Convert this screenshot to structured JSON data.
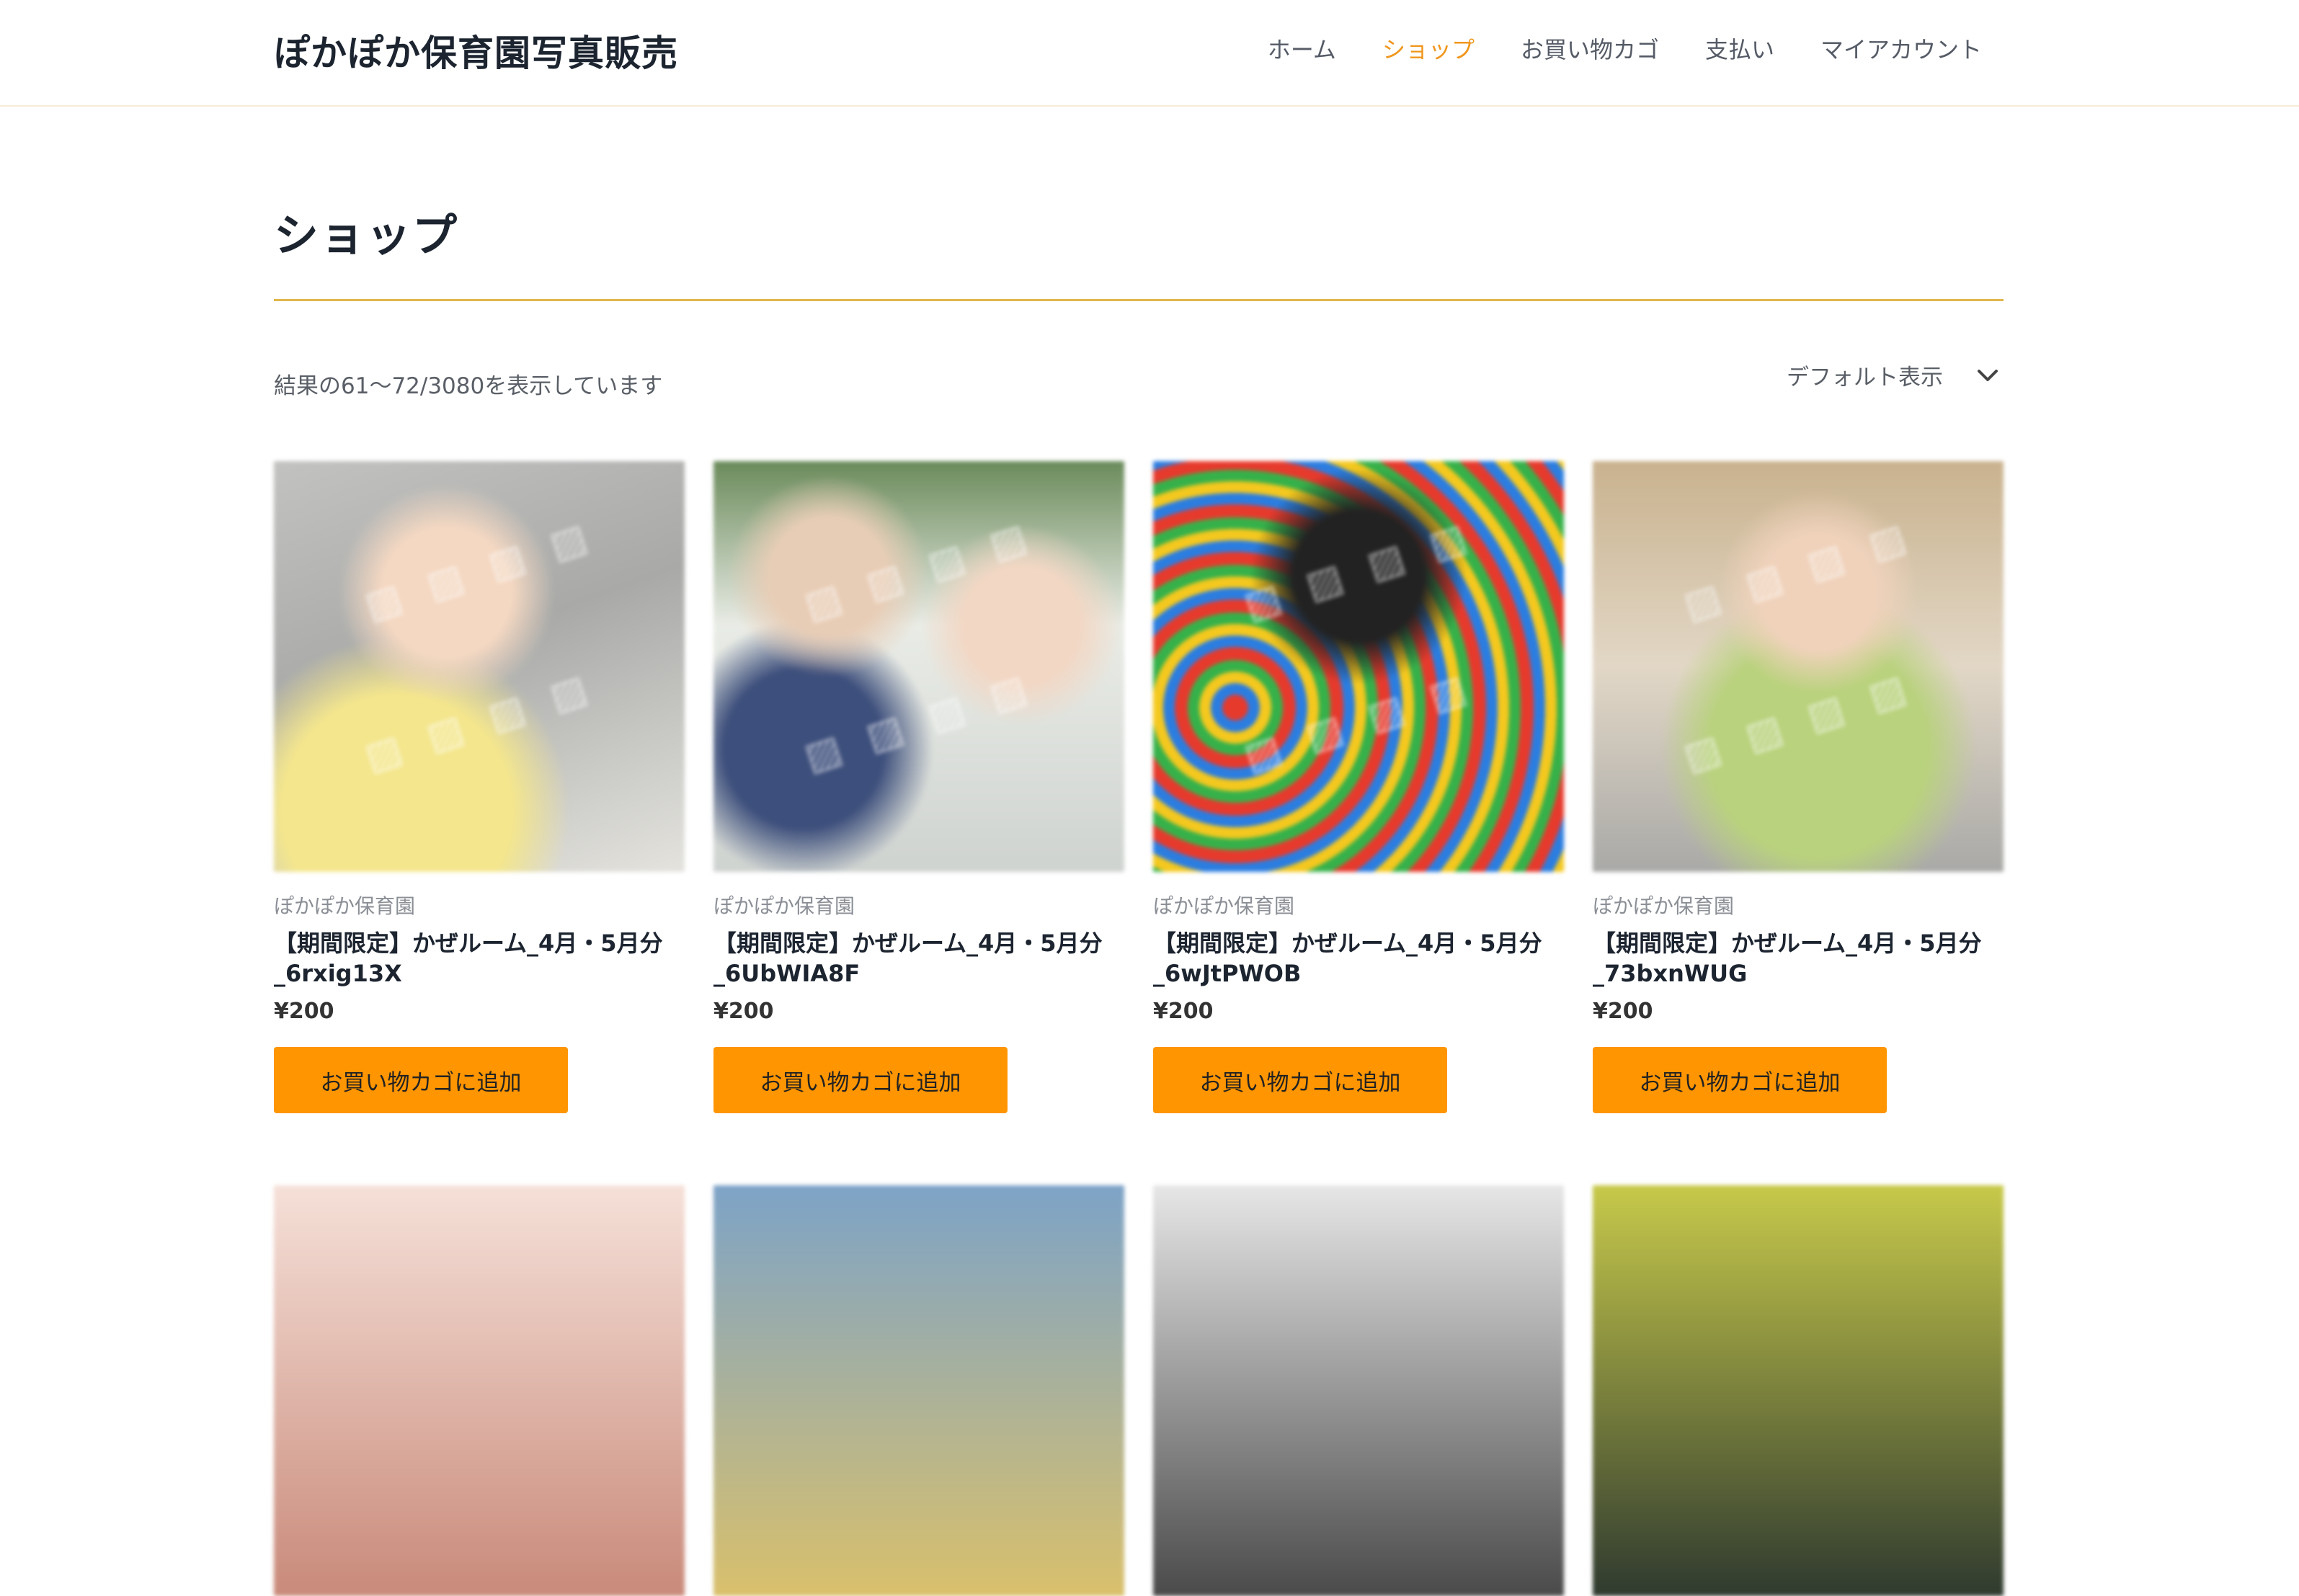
{
  "site": {
    "title": "ぽかぽか保育園写真販売"
  },
  "nav": [
    {
      "label": "ホーム",
      "active": false
    },
    {
      "label": "ショップ",
      "active": true
    },
    {
      "label": "お買い物カゴ",
      "active": false
    },
    {
      "label": "支払い",
      "active": false
    },
    {
      "label": "マイアカウント",
      "active": false
    }
  ],
  "page": {
    "title": "ショップ",
    "result_count": "結果の61〜72/3080を表示しています",
    "sort_selected": "デフォルト表示"
  },
  "colors": {
    "accent": "#ff9500",
    "nav_active": "#f0961d",
    "rule": "#e3b64b"
  },
  "products": [
    {
      "brand": "ぽかぽか保育園",
      "name": "【期間限定】かぜルーム_4月・5月分_6rxig13X",
      "price": "¥200",
      "button": "お買い物カゴに追加"
    },
    {
      "brand": "ぽかぽか保育園",
      "name": "【期間限定】かぜルーム_4月・5月分_6UbWIA8F",
      "price": "¥200",
      "button": "お買い物カゴに追加"
    },
    {
      "brand": "ぽかぽか保育園",
      "name": "【期間限定】かぜルーム_4月・5月分_6wJtPWOB",
      "price": "¥200",
      "button": "お買い物カゴに追加"
    },
    {
      "brand": "ぽかぽか保育園",
      "name": "【期間限定】かぜルーム_4月・5月分_73bxnWUG",
      "price": "¥200",
      "button": "お買い物カゴに追加"
    }
  ]
}
